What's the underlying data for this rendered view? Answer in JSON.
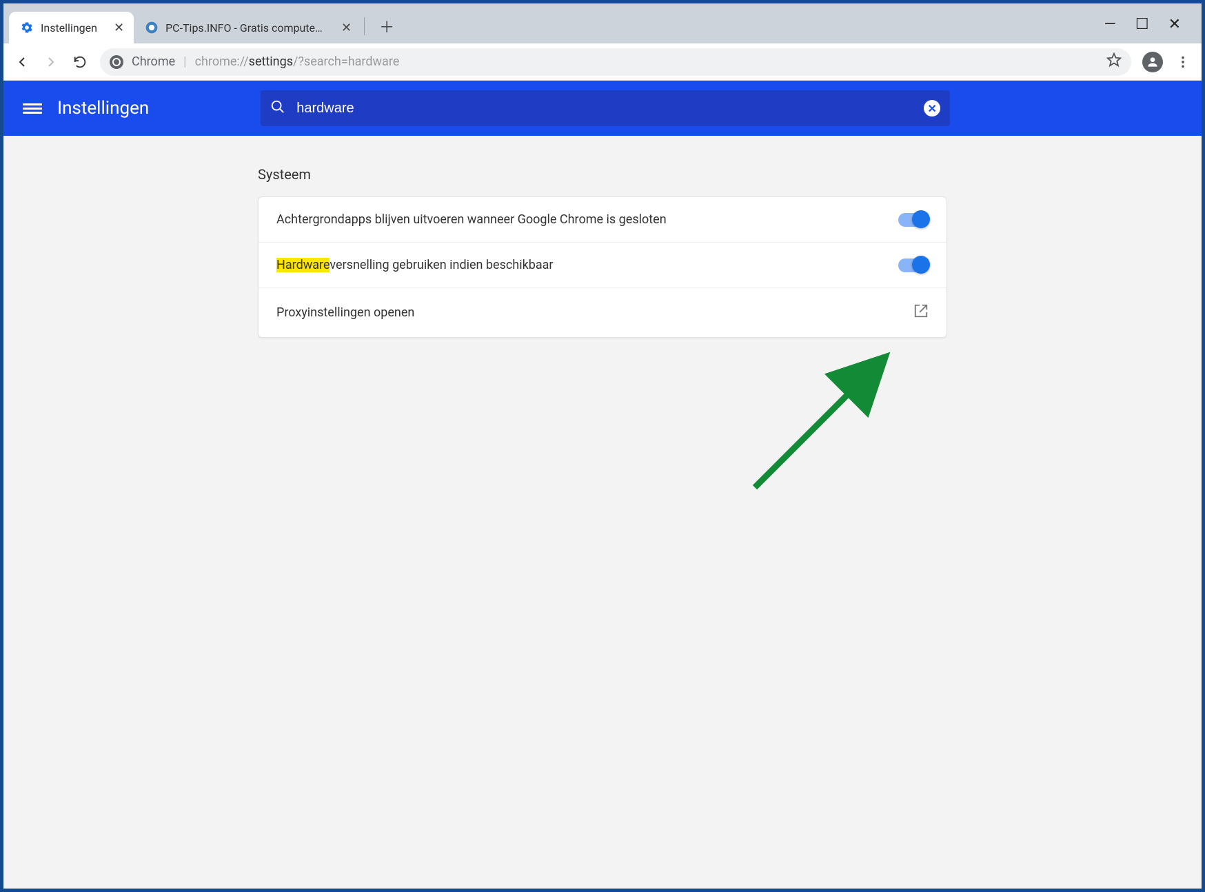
{
  "browser": {
    "tabs": [
      {
        "title": "Instellingen",
        "active": true
      },
      {
        "title": "PC-Tips.INFO - Gratis computer t",
        "active": false
      }
    ],
    "address": {
      "protocol_label": "Chrome",
      "url_prefix": "chrome://",
      "url_bold": "settings",
      "url_suffix": "/?search=hardware"
    }
  },
  "settings_header": {
    "title": "Instellingen",
    "search_value": "hardware"
  },
  "section": {
    "title": "Systeem",
    "rows": {
      "bgapps": {
        "label": "Achtergrondapps blijven uitvoeren wanneer Google Chrome is gesloten"
      },
      "hwaccel": {
        "label_hi": "Hardware",
        "label_rest": "versnelling gebruiken indien beschikbaar"
      },
      "proxy": {
        "label": "Proxyinstellingen openen"
      }
    }
  }
}
